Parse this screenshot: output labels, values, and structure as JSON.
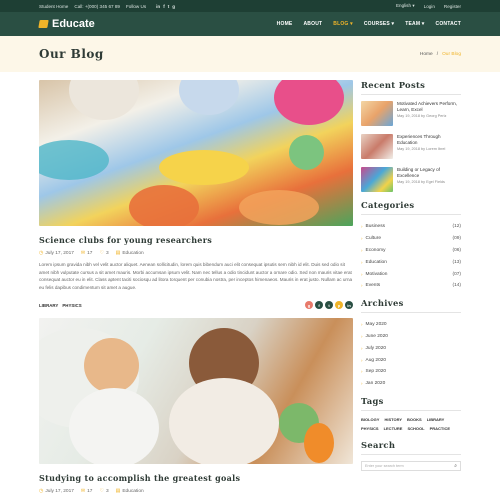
{
  "topbar": {
    "home": "Student Home",
    "call": "Call: +(000) 345 67 89",
    "follow": "Follow Us",
    "social": [
      "in",
      "f",
      "t",
      "g"
    ],
    "language": "English",
    "login": "Login",
    "register": "Register"
  },
  "header": {
    "logo": "Educate",
    "nav": [
      {
        "label": "HOME"
      },
      {
        "label": "ABOUT"
      },
      {
        "label": "BLOG ▾"
      },
      {
        "label": "COURSES ▾"
      },
      {
        "label": "TEAM ▾"
      },
      {
        "label": "CONTACT"
      }
    ]
  },
  "page": {
    "title": "Our Blog",
    "breadcrumb_home": "Home",
    "breadcrumb_sep": "/",
    "breadcrumb_current": "Our Blog"
  },
  "posts": [
    {
      "title": "Science clubs for young researchers",
      "date": "July 17, 2017",
      "comments": "17",
      "likes": "3",
      "category": "Education",
      "excerpt": "Lorem ipsum gravida nibh vel velit auctor aliquet. Aenean sollicitudin, lorem quis bibendum auci elit consequat ipsutis sem nibh id elit. Duis sed odio sit amet nibh vulputate cursus a sit amet mauris. Morbi accumsan ipsum velit. Nam nec tellus a odio tincidunt auctor a ornare odio. Sed non mauris vitae erat consequat auctor eu in elit. Class aptent taciti sociosqu ad litora torquent per conubia nostra, per inceptos himenaeos. Mauris in erat justo. Nullam ac urna eu felis dapibus condimentum sit amet a augue.",
      "tags": [
        "LIBRARY",
        "PHYSICS"
      ]
    },
    {
      "title": "Studying to accomplish the greatest goals",
      "date": "July 17, 2017",
      "comments": "17",
      "likes": "3",
      "category": "Education"
    }
  ],
  "share": [
    {
      "icon": "g",
      "color": "#e8796a"
    },
    {
      "icon": "f",
      "color": "#2a4f43"
    },
    {
      "icon": "t",
      "color": "#2a4f43"
    },
    {
      "icon": "p",
      "color": "#f0b429"
    },
    {
      "icon": "in",
      "color": "#2a4f43"
    }
  ],
  "sidebar": {
    "recent_title": "Recent Posts",
    "recent": [
      {
        "title": "Motivated Achievers Perform, Learn, Excel",
        "date": "May 19, 2018 by Georg Perlz"
      },
      {
        "title": "Experiences Through Education",
        "date": "May 19, 2018 by Lorem Ibrel"
      },
      {
        "title": "Building or Legacy of Excellence",
        "date": "May 19, 2018 by Egel Fields"
      }
    ],
    "categories_title": "Categories",
    "categories": [
      {
        "name": "Business",
        "count": "(12)"
      },
      {
        "name": "Culture",
        "count": "(09)"
      },
      {
        "name": "Economy",
        "count": "(06)"
      },
      {
        "name": "Education",
        "count": "(13)"
      },
      {
        "name": "Motivation",
        "count": "(07)"
      },
      {
        "name": "Events",
        "count": "(14)"
      }
    ],
    "archives_title": "Archives",
    "archives": [
      "May 2020",
      "June 2020",
      "July 2020",
      "Aug 2020",
      "Sep 2020",
      "Jan 2020"
    ],
    "tags_title": "Tags",
    "tags": [
      "BIOLOGY",
      "HISTORY",
      "BOOKS",
      "LIBRARY",
      "PHYSICS",
      "LECTURE",
      "SCHOOL",
      "PRACTICE"
    ],
    "search_title": "Search",
    "search_placeholder": "Enter your search term"
  }
}
